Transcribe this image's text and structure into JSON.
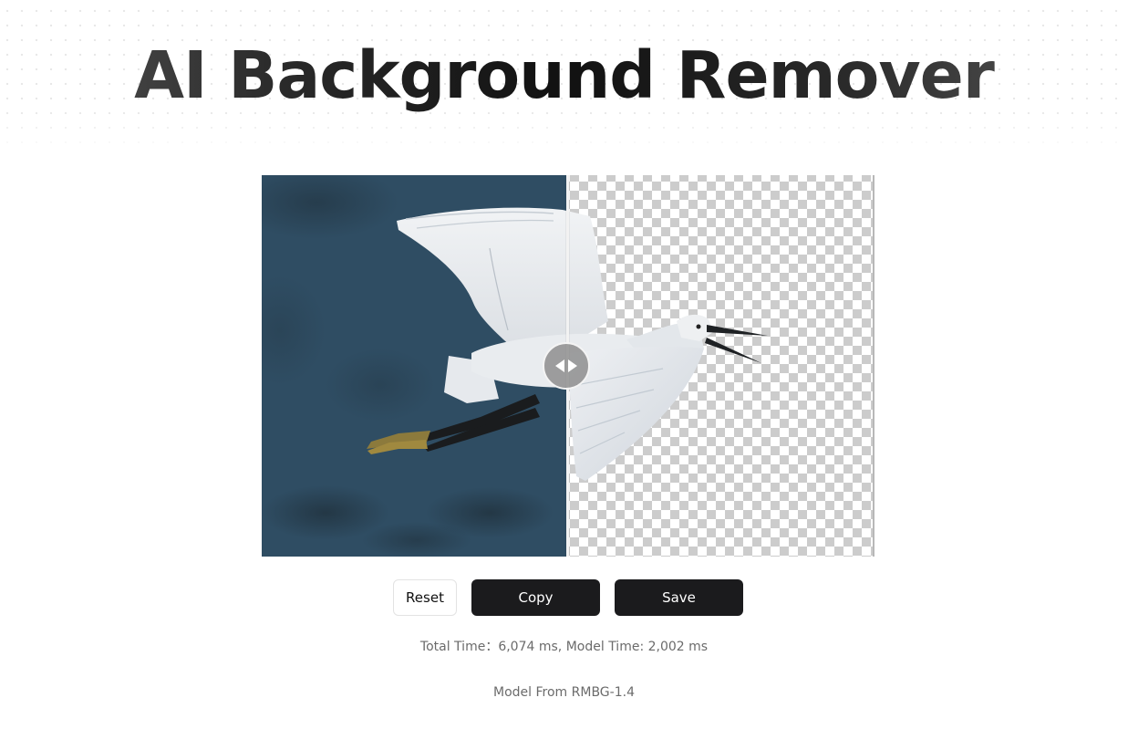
{
  "header": {
    "title": "AI Background Remover"
  },
  "comparison": {
    "original_label": "original image",
    "result_label": "background removed result",
    "subject": "egret in flight",
    "slider_position_percent": 50,
    "colors": {
      "water_background": "#2f4d63",
      "checker_dark": "#cccccc",
      "checker_light": "#ffffff"
    },
    "handle_icon": "arrows-left-right-icon"
  },
  "actions": {
    "reset_label": "Reset",
    "copy_label": "Copy",
    "save_label": "Save"
  },
  "stats": {
    "total_time_label": "Total Time：",
    "total_time_value": "6,074 ms",
    "separator": ", ",
    "model_time_label": "Model Time: ",
    "model_time_value": "2,002 ms"
  },
  "footer": {
    "prefix": "Model From ",
    "model_name": "RMBG-1.4"
  },
  "theme": {
    "button_dark": "#1b1b1d",
    "muted_text": "#6b6b6b"
  }
}
